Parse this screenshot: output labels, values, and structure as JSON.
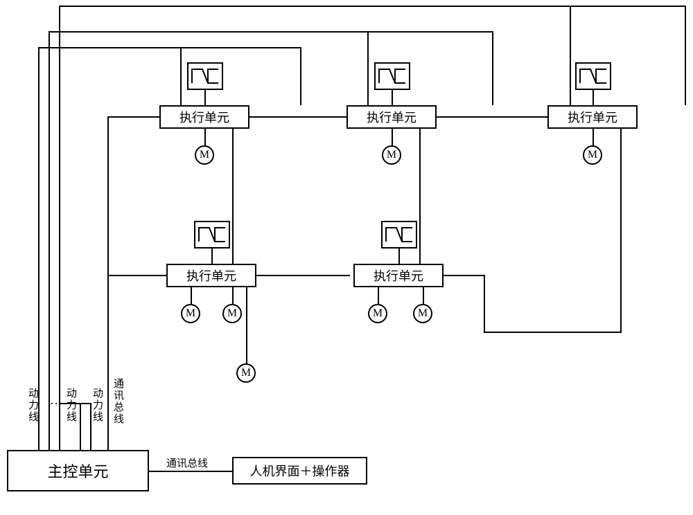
{
  "blocks": {
    "main_controller": "主控单元",
    "hmi": "人机界面＋操作器",
    "exec_unit": "执行单元"
  },
  "labels": {
    "power_line": "动力线",
    "comm_bus": "通讯总线",
    "ellipsis": "…",
    "motor": "M"
  },
  "chart_data": {
    "type": "diagram",
    "title": "",
    "description": "Block diagram of a control system",
    "nodes": [
      {
        "id": "main",
        "label": "主控单元",
        "role": "controller"
      },
      {
        "id": "hmi",
        "label": "人机界面＋操作器",
        "role": "interface"
      },
      {
        "id": "exec1",
        "label": "执行单元",
        "row": 1
      },
      {
        "id": "exec2",
        "label": "执行单元",
        "row": 1
      },
      {
        "id": "exec3",
        "label": "执行单元",
        "row": 1
      },
      {
        "id": "exec4",
        "label": "执行单元",
        "row": 2
      },
      {
        "id": "exec5",
        "label": "执行单元",
        "row": 2
      }
    ],
    "buses": [
      {
        "type": "power_line",
        "label": "动力线",
        "count": "multiple",
        "from": "main",
        "to": "exec_units_top"
      },
      {
        "type": "comm_bus",
        "label": "通讯总线",
        "from": "main",
        "to": "exec_units_rows"
      },
      {
        "type": "comm_bus",
        "label": "通讯总线",
        "from": "main",
        "to": "hmi"
      }
    ],
    "exec_to_motor": {
      "exec1": 1,
      "exec2": 1,
      "exec3": 1,
      "exec4": 3,
      "exec5": 2
    }
  }
}
